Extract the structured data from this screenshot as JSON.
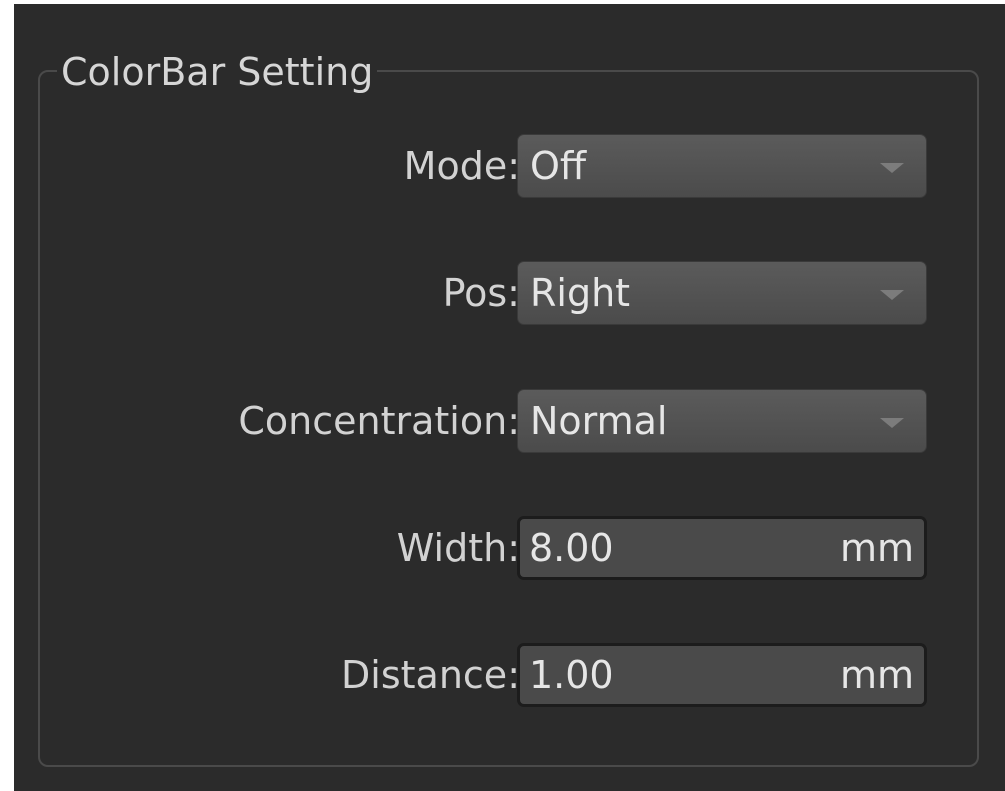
{
  "group": {
    "title": "ColorBar Setting"
  },
  "fields": [
    {
      "label": "Mode:",
      "value": "Off",
      "kind": "dropdown"
    },
    {
      "label": "Pos:",
      "value": "Right",
      "kind": "dropdown"
    },
    {
      "label": "Concentration:",
      "value": "Normal",
      "kind": "dropdown"
    },
    {
      "label": "Width:",
      "value": "8.00",
      "unit": "mm",
      "kind": "spinbox"
    },
    {
      "label": "Distance:",
      "value": "1.00",
      "unit": "mm",
      "kind": "spinbox"
    }
  ],
  "icons": {
    "dropdown_arrow": "chevron-down-icon"
  },
  "colors": {
    "background": "#2b2b2b",
    "frame": "#4a4a4a",
    "control": "#555555",
    "text": "#e6e6e6"
  }
}
